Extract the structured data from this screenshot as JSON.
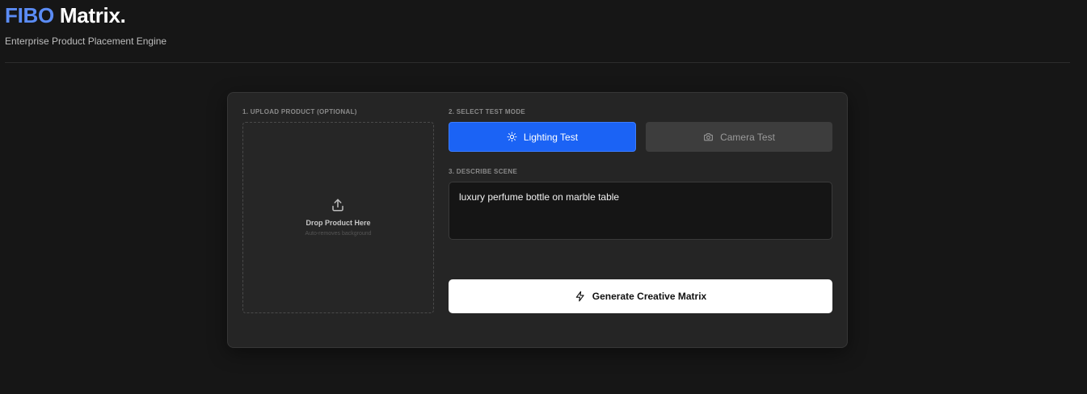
{
  "header": {
    "brand_accent": "FIBO",
    "brand_rest": "Matrix.",
    "subtitle": "Enterprise Product Placement Engine"
  },
  "upload": {
    "label": "1. UPLOAD PRODUCT (OPTIONAL)",
    "title": "Drop Product Here",
    "subtitle": "Auto-removes background",
    "icon": "upload-icon"
  },
  "mode": {
    "label": "2. SELECT TEST MODE",
    "options": [
      {
        "label": "Lighting Test",
        "icon": "sun-icon",
        "selected": true
      },
      {
        "label": "Camera Test",
        "icon": "camera-icon",
        "selected": false
      }
    ]
  },
  "scene": {
    "label": "3. DESCRIBE SCENE",
    "value": "luxury perfume bottle on marble table"
  },
  "generate": {
    "label": "Generate Creative Matrix",
    "icon": "lightning-icon"
  },
  "colors": {
    "accent": "#5b8cf5",
    "primary_button": "#1b63f5",
    "background": "#161616",
    "card": "#252525"
  }
}
